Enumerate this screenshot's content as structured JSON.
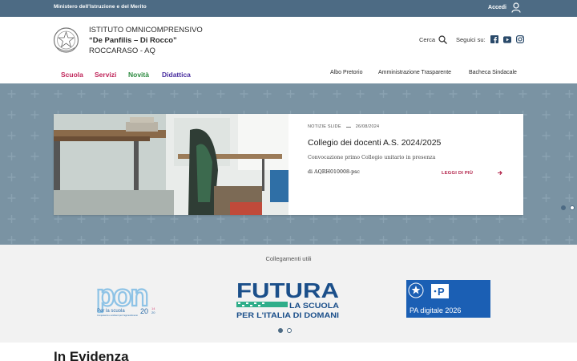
{
  "topbar": {
    "ministry": "Ministero dell'Istruzione e del Merito",
    "login_label": "Accedi"
  },
  "header": {
    "name_line1": "ISTITUTO OMNICOMPRENSIVO",
    "name_line2": "“De Panfilis – Di Rocco”",
    "name_line3": "ROCCARASO - AQ",
    "search_label": "Cerca",
    "social_label": "Seguici su:",
    "social_icons": [
      "facebook-icon",
      "youtube-icon",
      "instagram-icon"
    ]
  },
  "main_nav": [
    {
      "label": "Scuola",
      "color": "#c0265a"
    },
    {
      "label": "Servizi",
      "color": "#c0265a"
    },
    {
      "label": "Novità",
      "color": "#2c8a3f"
    },
    {
      "label": "Didattica",
      "color": "#4a2fa0"
    }
  ],
  "secondary_nav": [
    "Albo Pretorio",
    "Amministrazione Trasparente",
    "Bacheca Sindacale"
  ],
  "hero": {
    "category": "NOTIZIE SLIDE",
    "date": "26/08/2024",
    "title": "Collegio dei docenti A.S. 2024/2025",
    "description": "Convocazione primo Collegio unitario in presenza",
    "author": "di AQRH010008-psc",
    "read_more": "LEGGI DI PIÙ",
    "slide_count": 5,
    "active_slide": 1
  },
  "links": {
    "title": "Collegamenti utili",
    "items": [
      {
        "name": "pon",
        "caption": "Per la scuola",
        "sub": "Competenze e ambienti per l'apprendimento"
      },
      {
        "name": "futura",
        "line1": "FUTURA",
        "line2": "LA SCUOLA",
        "line3": "PER L'ITALIA DI DOMANI"
      },
      {
        "name": "pa-digitale",
        "label": "PA digitale 2026"
      }
    ],
    "page_count": 2,
    "active_page": 1
  },
  "evidenza": {
    "title": "In Evidenza"
  },
  "colors": {
    "topbar": "#4d6b84",
    "hero_bg": "#7a93a3",
    "accent_red": "#b01c44",
    "futura_blue": "#1b4f8a",
    "pa_blue": "#1b5fb4"
  }
}
